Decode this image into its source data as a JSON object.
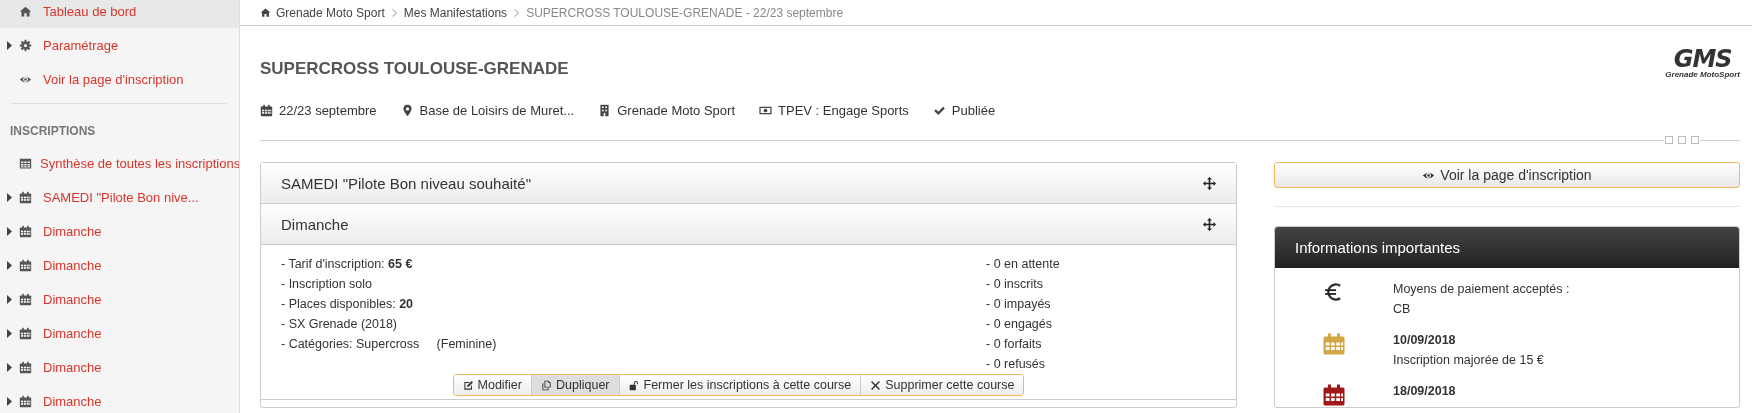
{
  "sidebar": {
    "items": [
      {
        "kind": "home",
        "label": "Tableau de bord",
        "selected": true
      },
      {
        "kind": "gear",
        "label": "Paramétrage",
        "selected": false,
        "expanded": false
      },
      {
        "kind": "eye",
        "label": "Voir la page d'inscription",
        "selected": false
      }
    ],
    "section_title": "INSCRIPTIONS",
    "section_items": [
      {
        "kind": "table",
        "label": "Synthèse de toutes les inscriptions",
        "selected": false
      },
      {
        "kind": "calendar",
        "label": "SAMEDI \"Pilote Bon nive...",
        "selected": false,
        "expanded": false
      },
      {
        "kind": "calendar",
        "label": "Dimanche",
        "selected": false,
        "expanded": false
      },
      {
        "kind": "calendar",
        "label": "Dimanche",
        "selected": false,
        "expanded": false
      },
      {
        "kind": "calendar",
        "label": "Dimanche",
        "selected": false,
        "expanded": false
      },
      {
        "kind": "calendar",
        "label": "Dimanche",
        "selected": false,
        "expanded": false
      },
      {
        "kind": "calendar",
        "label": "Dimanche",
        "selected": false,
        "expanded": false
      },
      {
        "kind": "calendar",
        "label": "Dimanche",
        "selected": false,
        "expanded": false
      }
    ]
  },
  "breadcrumb": [
    "Grenade Moto Sport",
    "Mes Manifestations",
    "SUPERCROSS TOULOUSE-GRENADE - 22/23 septembre"
  ],
  "event": {
    "title": "SUPERCROSS TOULOUSE-GRENADE",
    "logo": {
      "name": "GMS",
      "tagline": "Grenade MotoSport"
    },
    "meta": [
      {
        "kind": "calendar",
        "text": "22/23 septembre"
      },
      {
        "kind": "pin",
        "text": "Base de Loisirs de Muret..."
      },
      {
        "kind": "building",
        "text": "Grenade Moto Sport"
      },
      {
        "kind": "money",
        "text": "TPEV : Engage Sports"
      },
      {
        "kind": "check",
        "text": "Publiée"
      }
    ]
  },
  "races": [
    {
      "title": "SAMEDI \"Pilote Bon niveau souhaité\""
    },
    {
      "title": "Dimanche",
      "details": [
        "- Tarif d'inscription: **65 €**",
        "- Inscription solo",
        "- Places disponibles: **20**",
        "- SX Grenade (2018)",
        "- Catégories: Supercross     (Feminine)"
      ],
      "counts": [
        "- 0 en attente",
        "- 0 inscrits",
        "- 0 impayés",
        "- 0 engagés",
        "- 0 forfaits",
        "- 0 refusés"
      ],
      "actions": [
        {
          "kind": "edit",
          "label": "Modifier",
          "pressed": false
        },
        {
          "kind": "copy",
          "label": "Dupliquer",
          "pressed": true
        },
        {
          "kind": "unlock",
          "label": "Fermer les inscriptions à cette course",
          "pressed": false
        },
        {
          "kind": "delete",
          "label": "Supprimer cette course",
          "pressed": false
        }
      ]
    }
  ],
  "aside": {
    "view_button": "Voir la page d'inscription",
    "info": {
      "title": "Informations importantes",
      "items": [
        {
          "kind": "payment",
          "title": "Moyens de paiement acceptés :",
          "text": "CB"
        },
        {
          "kind": "date",
          "color": "#d4a545",
          "title": "10/09/2018",
          "text": "Inscription majorée de 15 €"
        },
        {
          "kind": "date",
          "color": "#a01818",
          "title": "18/09/2018"
        }
      ]
    }
  }
}
